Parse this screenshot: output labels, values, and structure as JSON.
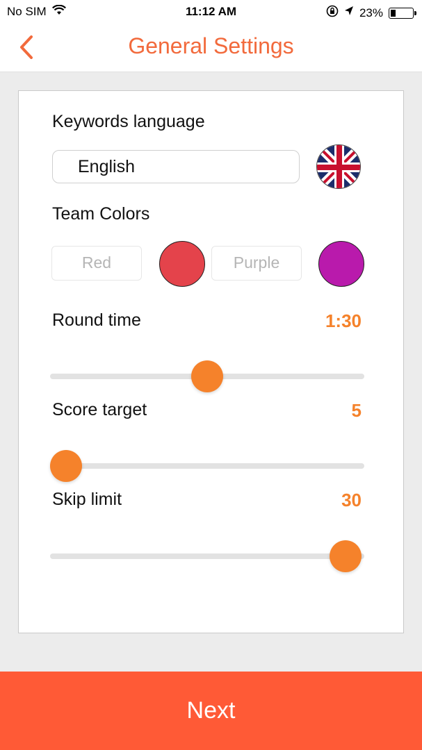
{
  "status_bar": {
    "carrier": "No SIM",
    "time": "11:12 AM",
    "battery": "23%",
    "battery_level": 0.23,
    "icons": [
      "wifi-icon",
      "orientation-lock-icon",
      "location-arrow-icon",
      "battery-icon"
    ]
  },
  "nav": {
    "title": "General Settings",
    "back_icon": "chevron-left-icon"
  },
  "settings": {
    "keywords_language": {
      "label": "Keywords language",
      "value": "English",
      "flag_icon": "uk-flag-icon"
    },
    "team_colors": {
      "label": "Team Colors",
      "teams": [
        {
          "placeholder": "Red",
          "color": "#e4434b"
        },
        {
          "placeholder": "Purple",
          "color": "#b91aac"
        }
      ]
    },
    "round_time": {
      "label": "Round time",
      "value": "1:30",
      "fraction": 0.5
    },
    "score_target": {
      "label": "Score target",
      "value": "5",
      "fraction": 0.05
    },
    "skip_limit": {
      "label": "Skip limit",
      "value": "30",
      "fraction": 0.94
    }
  },
  "footer": {
    "next_label": "Next"
  },
  "colors": {
    "accent": "#f5822b",
    "title": "#f26a3c",
    "next_bg": "#ff5a36"
  }
}
